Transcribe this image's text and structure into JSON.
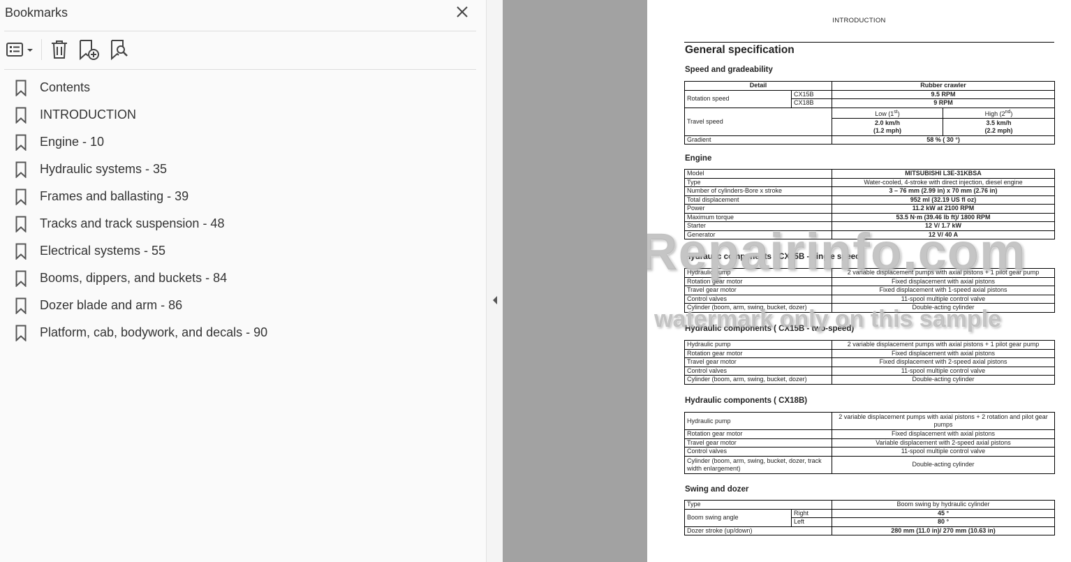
{
  "sidebar": {
    "title": "Bookmarks",
    "bookmarks": [
      {
        "label": "Contents"
      },
      {
        "label": "INTRODUCTION"
      },
      {
        "label": "Engine - 10"
      },
      {
        "label": "Hydraulic systems - 35"
      },
      {
        "label": "Frames and ballasting - 39"
      },
      {
        "label": "Tracks and track suspension - 48"
      },
      {
        "label": "Electrical systems - 55"
      },
      {
        "label": "Booms, dippers, and buckets - 84"
      },
      {
        "label": "Dozer blade and arm - 86"
      },
      {
        "label": "Platform, cab, bodywork, and decals - 90"
      }
    ]
  },
  "document": {
    "running_head": "INTRODUCTION",
    "title": "General specification",
    "speed": {
      "heading": "Speed and gradeability",
      "col_detail": "Detail",
      "col_rubber": "Rubber crawler",
      "rotation_label": "Rotation speed",
      "cx15b": "CX15B",
      "cx18b": "CX18B",
      "cx15b_rpm": "9.5 RPM",
      "cx18b_rpm": "9 RPM",
      "travel_label": "Travel speed",
      "low_label": "Low (1",
      "low_sup": "st",
      "high_label": "High (2",
      "high_sup": "nd",
      "close_paren": ")",
      "low_value": "2.0 km/h",
      "low_mph": "(1.2 mph)",
      "high_value": "3.5 km/h",
      "high_mph": "(2.2 mph)",
      "gradient_label": "Gradient",
      "gradient_value": "58 % ( 30 °)"
    },
    "engine": {
      "heading": "Engine",
      "rows": [
        [
          "Model",
          "MITSUBISHI L3E-31KBSA"
        ],
        [
          "Type",
          "Water-cooled, 4-stroke with direct injection, diesel engine"
        ],
        [
          "Number of cylinders-Bore x stroke",
          "3 – 76 mm (2.99 in) x 70 mm (2.76 in)"
        ],
        [
          "Total displacement",
          "952 ml (32.19 US fl oz)"
        ],
        [
          "Power",
          "11.2 kW at 2100 RPM"
        ],
        [
          "Maximum torque",
          "53.5 N·m (39.46 lb ft)/ 1800 RPM"
        ],
        [
          "Starter",
          "12 V/ 1.7 kW"
        ],
        [
          "Generator",
          "12 V/ 40 A"
        ]
      ]
    },
    "hyd1": {
      "heading": "Hydraulic components ( CX15B - single speed)",
      "rows": [
        [
          "Hydraulic pump",
          "2 variable displacement pumps with axial pistons + 1 pilot gear pump"
        ],
        [
          "Rotation gear motor",
          "Fixed displacement with axial pistons"
        ],
        [
          "Travel gear motor",
          "Fixed displacement with 1-speed axial pistons"
        ],
        [
          "Control valves",
          "11-spool multiple control valve"
        ],
        [
          "Cylinder (boom, arm, swing, bucket, dozer)",
          "Double-acting cylinder"
        ]
      ]
    },
    "hyd2": {
      "heading": "Hydraulic components ( CX15B - two-speed)",
      "rows": [
        [
          "Hydraulic pump",
          "2 variable displacement pumps with axial pistons + 1 pilot gear pump"
        ],
        [
          "Rotation gear motor",
          "Fixed displacement with axial pistons"
        ],
        [
          "Travel gear motor",
          "Fixed displacement with 2-speed axial pistons"
        ],
        [
          "Control valves",
          "11-spool multiple control valve"
        ],
        [
          "Cylinder (boom, arm, swing, bucket, dozer)",
          "Double-acting cylinder"
        ]
      ]
    },
    "hyd3": {
      "heading": "Hydraulic components ( CX18B)",
      "pump_label": "Hydraulic pump",
      "pump_value": "2 variable displacement pumps with axial pistons + 2 rotation and pilot gear pumps",
      "rotation_label": "Rotation gear motor",
      "rotation_value": "Fixed displacement with axial pistons",
      "travel_label": "Travel gear motor",
      "travel_value": "Variable displacement with 2-speed axial pistons",
      "valves_label": "Control valves",
      "valves_value": "11-spool multiple control valve",
      "cyl_label": "Cylinder (boom, arm, swing, bucket, dozer, track width enlargement)",
      "cyl_value": "Double-acting cylinder"
    },
    "swing": {
      "heading": "Swing and dozer",
      "type_label": "Type",
      "type_value": "Boom swing by hydraulic cylinder",
      "angle_label": "Boom swing angle",
      "right_label": "Right",
      "right_value": "45 °",
      "left_label": "Left",
      "left_value": "80 °",
      "stroke_label": "Dozer stroke (up/down)",
      "stroke_value": "280 mm (11.0 in)/ 270 mm (10.63 in)"
    },
    "watermark_1": "eRepairinfo.com",
    "watermark_2": "watermark only on this sample"
  }
}
